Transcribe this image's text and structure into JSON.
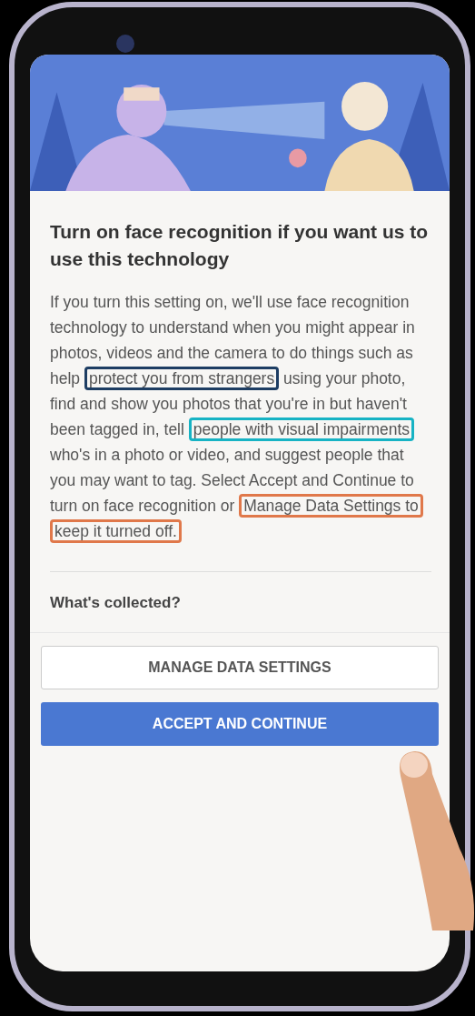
{
  "dialog": {
    "title": "Turn on face recognition if you want us to use this technology",
    "body": [
      {
        "text": "If you turn this setting on, we'll use face recognition technology to understand when you might appear in photos, videos and the camera to do things such as help "
      },
      {
        "text": "protect you from strangers",
        "color": "#1d3d63"
      },
      {
        "text": " using your photo, find and show you photos that you're in but haven't been tagged in, tell "
      },
      {
        "text": "people with visual impairments",
        "color": "#17b3c4"
      },
      {
        "text": " who's in a photo or video, and suggest people that you may want to tag. Select Accept and Continue to turn on face recognition or "
      },
      {
        "text": "Manage Data Settings to keep it turned off.",
        "color": "#e0784a"
      }
    ],
    "section": "What's collected?",
    "buttons": [
      {
        "label": "MANAGE DATA SETTINGS",
        "kind": "secondary"
      },
      {
        "label": "ACCEPT AND CONTINUE",
        "kind": "primary"
      }
    ]
  }
}
